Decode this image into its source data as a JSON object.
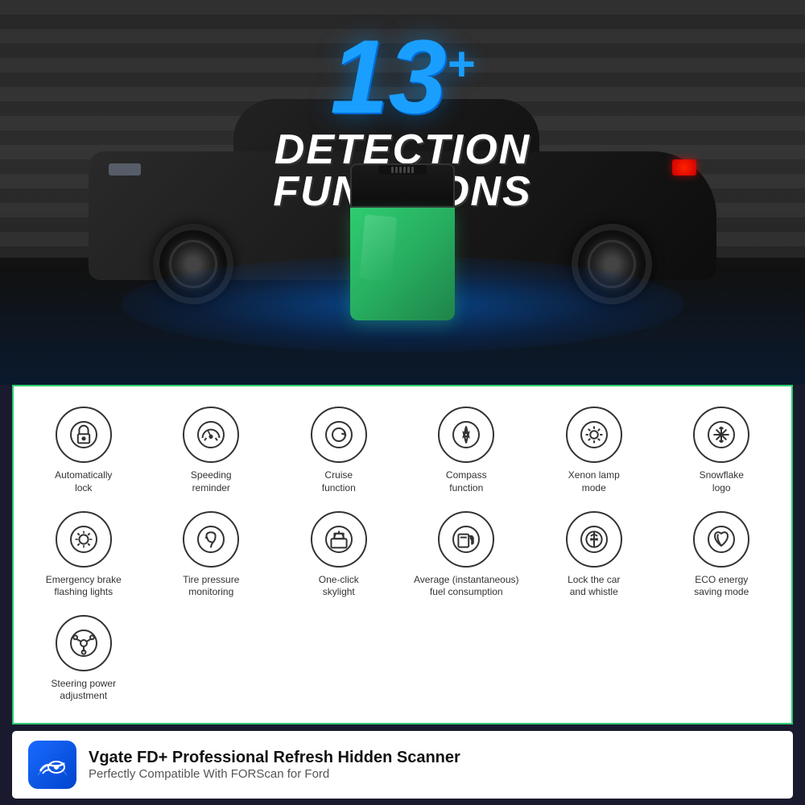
{
  "header": {
    "number": "13",
    "plus": "+",
    "line1": "DETECTION",
    "line2": "FUNCTIONS"
  },
  "features_row1": [
    {
      "id": "auto-lock",
      "icon": "🔒",
      "label": "Automatically\nlock"
    },
    {
      "id": "speeding",
      "icon": "🕐",
      "label": "Speeding\nreminder"
    },
    {
      "id": "cruise",
      "icon": "↻",
      "label": "Cruise\nfunction"
    },
    {
      "id": "compass",
      "icon": "🧭",
      "label": "Compass\nfunction"
    },
    {
      "id": "xenon",
      "icon": "💡",
      "label": "Xenon lamp\nmode"
    },
    {
      "id": "snowflake",
      "icon": "❄",
      "label": "Snowflake\nlogo"
    }
  ],
  "features_row2": [
    {
      "id": "emergency",
      "icon": "💡",
      "label": "Emergency brake\nflashing lights"
    },
    {
      "id": "tire-pressure",
      "icon": "🌀",
      "label": "Tire pressure\nmonitoring"
    },
    {
      "id": "skylight",
      "icon": "🚗",
      "label": "One-click\nskylight"
    },
    {
      "id": "fuel",
      "icon": "⛽",
      "label": "Average (instantaneous)\nfuel consumption"
    },
    {
      "id": "lock-whistle",
      "icon": "🔑",
      "label": "Lock the car\nand whistle"
    },
    {
      "id": "eco",
      "icon": "🌿",
      "label": "ECO energy\nsaving mode"
    },
    {
      "id": "steering",
      "icon": "⚙",
      "label": "Steering power\nadjustment"
    }
  ],
  "banner": {
    "title": "Vgate FD+ Professional Refresh Hidden Scanner",
    "subtitle": "Perfectly Compatible With FORScan for Ford"
  }
}
